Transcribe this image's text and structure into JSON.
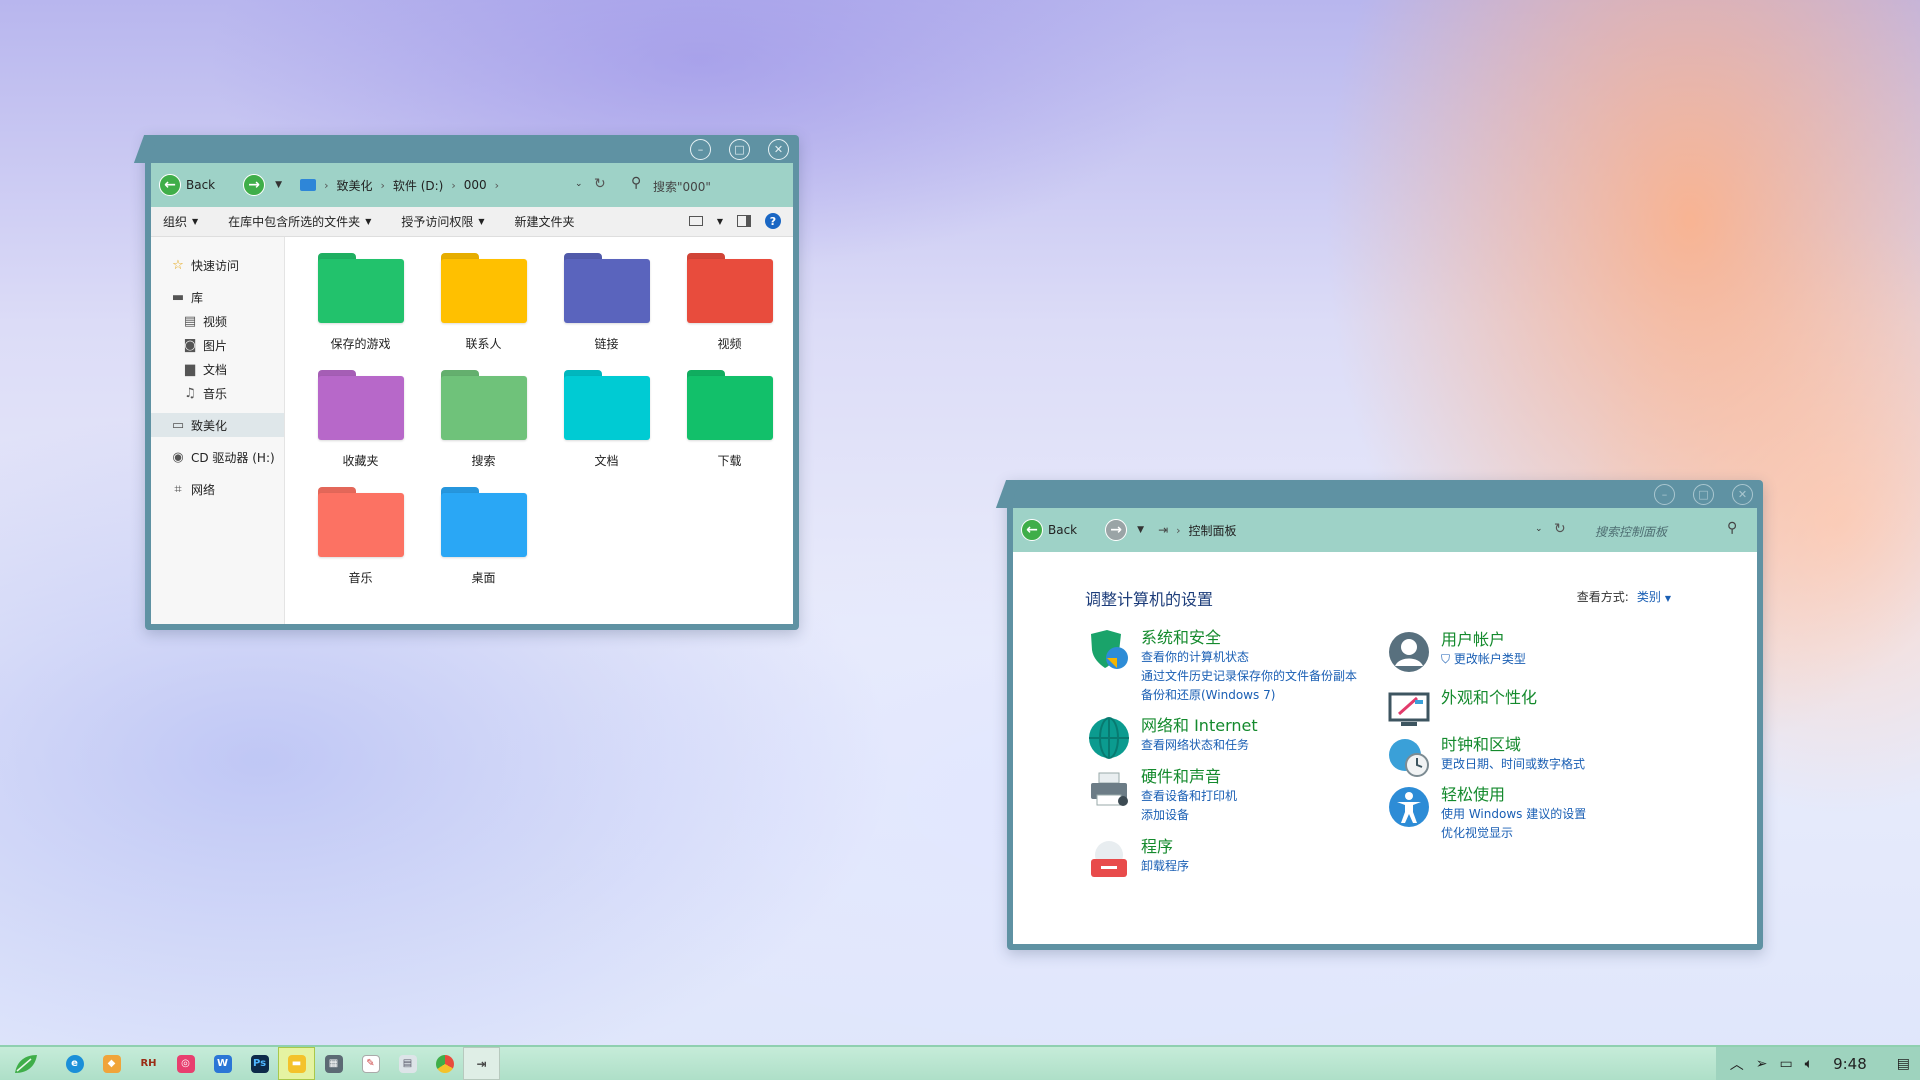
{
  "explorer": {
    "back_label": "Back",
    "breadcrumb": [
      "致美化",
      "软件 (D:)",
      "000"
    ],
    "search_placeholder": "搜索\"000\"",
    "toolbar": [
      "组织",
      "在库中包含所选的文件夹",
      "授予访问权限",
      "新建文件夹"
    ],
    "sidebar": {
      "quick_access": "快速访问",
      "library": "库",
      "library_items": [
        "视频",
        "图片",
        "文档",
        "音乐"
      ],
      "this_pc": "致美化",
      "cd_drive": "CD 驱动器 (H:)",
      "network": "网络"
    },
    "folders": [
      {
        "label": "保存的游戏",
        "color": "#22c26c"
      },
      {
        "label": "联系人",
        "color": "#ffc000"
      },
      {
        "label": "链接",
        "color": "#5a64bd"
      },
      {
        "label": "视频",
        "color": "#e84c3d"
      },
      {
        "label": "收藏夹",
        "color": "#b768c9"
      },
      {
        "label": "搜索",
        "color": "#6fc27a"
      },
      {
        "label": "文档",
        "color": "#00cbd3"
      },
      {
        "label": "下载",
        "color": "#12c06a"
      },
      {
        "label": "音乐",
        "color": "#fc7263"
      },
      {
        "label": "桌面",
        "color": "#2aa7f5"
      }
    ]
  },
  "cpanel": {
    "back_label": "Back",
    "breadcrumb": "控制面板",
    "search_placeholder": "搜索控制面板",
    "heading": "调整计算机的设置",
    "view_label": "查看方式:",
    "view_value": "类别",
    "categories_left": [
      {
        "title": "系统和安全",
        "links": [
          "查看你的计算机状态",
          "通过文件历史记录保存你的文件备份副本",
          "备份和还原(Windows 7)"
        ],
        "icon": "shield-icon"
      },
      {
        "title": "网络和 Internet",
        "links": [
          "查看网络状态和任务"
        ],
        "icon": "globe-icon"
      },
      {
        "title": "硬件和声音",
        "links": [
          "查看设备和打印机",
          "添加设备"
        ],
        "icon": "printer-icon"
      },
      {
        "title": "程序",
        "links": [
          "卸载程序"
        ],
        "icon": "program-icon"
      }
    ],
    "categories_right": [
      {
        "title": "用户帐户",
        "links": [
          "更改帐户类型"
        ],
        "icon": "user-icon"
      },
      {
        "title": "外观和个性化",
        "links": [],
        "icon": "monitor-icon"
      },
      {
        "title": "时钟和区域",
        "links": [
          "更改日期、时间或数字格式"
        ],
        "icon": "clock-globe-icon"
      },
      {
        "title": "轻松使用",
        "links": [
          "使用 Windows 建议的设置",
          "优化视觉显示"
        ],
        "icon": "accessibility-icon"
      }
    ]
  },
  "taskbar": {
    "clock": "9:48",
    "apps": [
      "leaf-start-icon",
      "edge-icon",
      "paint-icon",
      "rh-icon",
      "camera-icon",
      "writer-icon",
      "photoshop-icon",
      "explorer-icon",
      "calculator-icon",
      "notepad-icon",
      "clipboard-icon",
      "chrome-icon",
      "control-panel-icon"
    ],
    "app_text": {
      "rh": "RH",
      "ps": "Ps",
      "w": "W"
    }
  }
}
